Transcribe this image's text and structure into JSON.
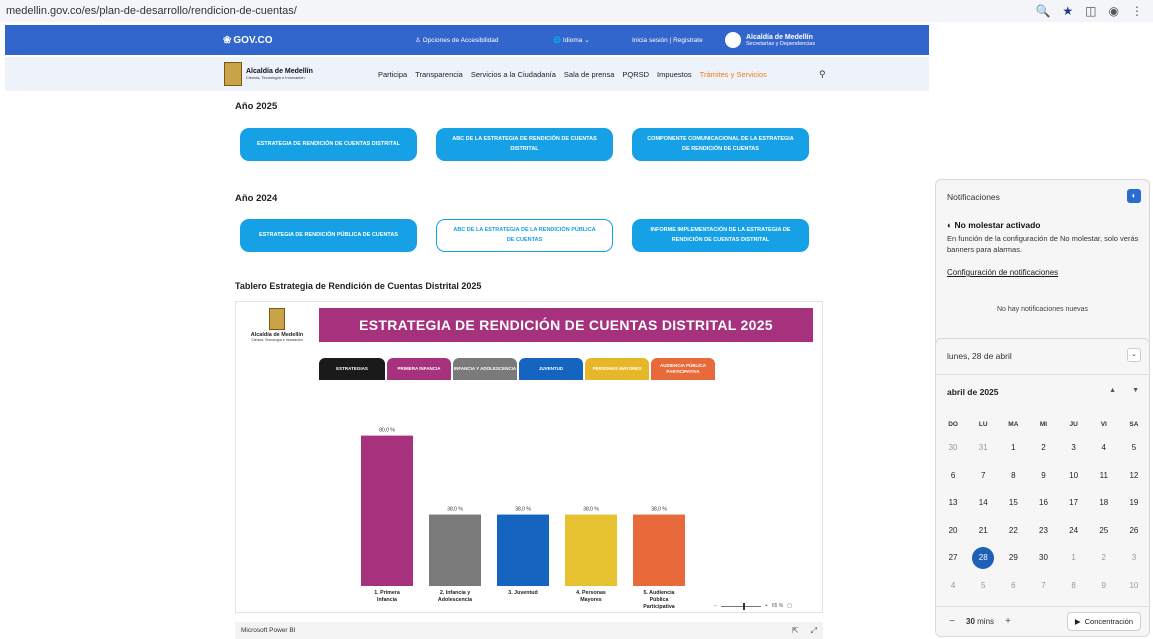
{
  "browser": {
    "url": "medellin.gov.co/es/plan-de-desarrollo/rendicion-de-cuentas/",
    "icons": [
      "zoom-icon",
      "star-icon",
      "extensions-icon",
      "profile-icon",
      "menu-icon"
    ]
  },
  "govbar": {
    "logo": "GOV.CO",
    "accessibility": "Opciones de Accesibilidad",
    "language": "Idioma",
    "login": "Inicia sesión  |  Registrate",
    "alcaldia_title": "Alcaldía de Medellín",
    "alcaldia_sub": "Secretarías y Dependencias"
  },
  "sitenav": {
    "brand_title": "Alcaldía de Medellín",
    "brand_sub": "Ciencia, Tecnología e Innovación",
    "items": [
      "Participa",
      "Transparencia",
      "Servicios a la Ciudadanía",
      "Sala de prensa",
      "PQRSD",
      "Impuestos",
      "Trámites y Servicios"
    ]
  },
  "section2025": {
    "heading": "Año 2025",
    "buttons": [
      "ESTRATEGIA DE RENDICIÓN DE CUENTAS DISTRITAL",
      "ABC DE LA ESTRATEGIA DE RENDICIÓN DE CUENTAS DISTRITAL",
      "COMPONENTE COMUNICACIONAL DE LA ESTRATEGIA DE RENDICIÓN DE CUENTAS"
    ]
  },
  "section2024": {
    "heading": "Año 2024",
    "buttons": [
      "ESTRATEGIA DE RENDICIÓN PÚBLICA DE CUENTAS",
      "ABC DE LA ESTRATEGIA DE LA RENDICIÓN PÚBLICA DE CUENTAS",
      "INFORME IMPLEMENTACIÓN DE LA ESTRATEGIA DE RENDICIÓN DE CUENTAS DISTRITAL"
    ]
  },
  "dashboard": {
    "title": "Tablero Estrategia de Rendición de Cuentas Distrital 2025",
    "logo_title": "Alcaldía de Medellín",
    "logo_sub": "Ciencia, Tecnología e Innovación",
    "banner": "ESTRATEGIA DE RENDICIÓN DE CUENTAS DISTRITAL 2025",
    "tabs": [
      {
        "label": "ESTRATEGIAS",
        "color": "#1a1a1a"
      },
      {
        "label": "PRIMERA INFANCIA",
        "color": "#a6327e"
      },
      {
        "label": "INFANCIA Y ADOLESCENCIA",
        "color": "#7a7a7a"
      },
      {
        "label": "JUVENTUD",
        "color": "#1565c0"
      },
      {
        "label": "PERSONAS MAYORES",
        "color": "#e6b829"
      },
      {
        "label": "AUDIENCIA PÚBLICA PARTICIPATIVA",
        "color": "#e8693a"
      }
    ],
    "zoom": "65 %",
    "footer": "Microsoft Power BI"
  },
  "chart_data": {
    "type": "bar",
    "categories": [
      "1. Primera Infancia",
      "2. Infancia y Adolescencia",
      "3. Juventud",
      "4. Personas Mayores",
      "5. Audiencia Pública Participativa"
    ],
    "values": [
      80.0,
      38.0,
      38.0,
      38.0,
      38.0
    ],
    "value_labels": [
      "80,0 %",
      "38,0 %",
      "38,0 %",
      "38,0 %",
      "38,0 %"
    ],
    "colors": [
      "#a6327e",
      "#7a7a7a",
      "#1565c0",
      "#e6c230",
      "#e8693a"
    ],
    "ylim": [
      0,
      100
    ],
    "grid": false
  },
  "notifications": {
    "header": "Notificaciones",
    "dnd_title": "No molestar activado",
    "dnd_text": "En función de la configuración de No molestar, solo verás banners para alarmas.",
    "settings_link": "Configuración de notificaciones",
    "empty": "No hay notificaciones nuevas"
  },
  "calendar": {
    "date": "lunes, 28 de abril",
    "month": "abril de 2025",
    "weekdays": [
      "DO",
      "LU",
      "MA",
      "MI",
      "JU",
      "VI",
      "SA"
    ],
    "days": [
      [
        "30",
        "31",
        "1",
        "2",
        "3",
        "4",
        "5"
      ],
      [
        "6",
        "7",
        "8",
        "9",
        "10",
        "11",
        "12"
      ],
      [
        "13",
        "14",
        "15",
        "16",
        "17",
        "18",
        "19"
      ],
      [
        "20",
        "21",
        "22",
        "23",
        "24",
        "25",
        "26"
      ],
      [
        "27",
        "28",
        "29",
        "30",
        "1",
        "2",
        "3"
      ],
      [
        "4",
        "5",
        "6",
        "7",
        "8",
        "9",
        "10"
      ]
    ],
    "today": "28",
    "focus_minutes": "30",
    "focus_unit": "mins",
    "focus_button": "Concentración"
  }
}
